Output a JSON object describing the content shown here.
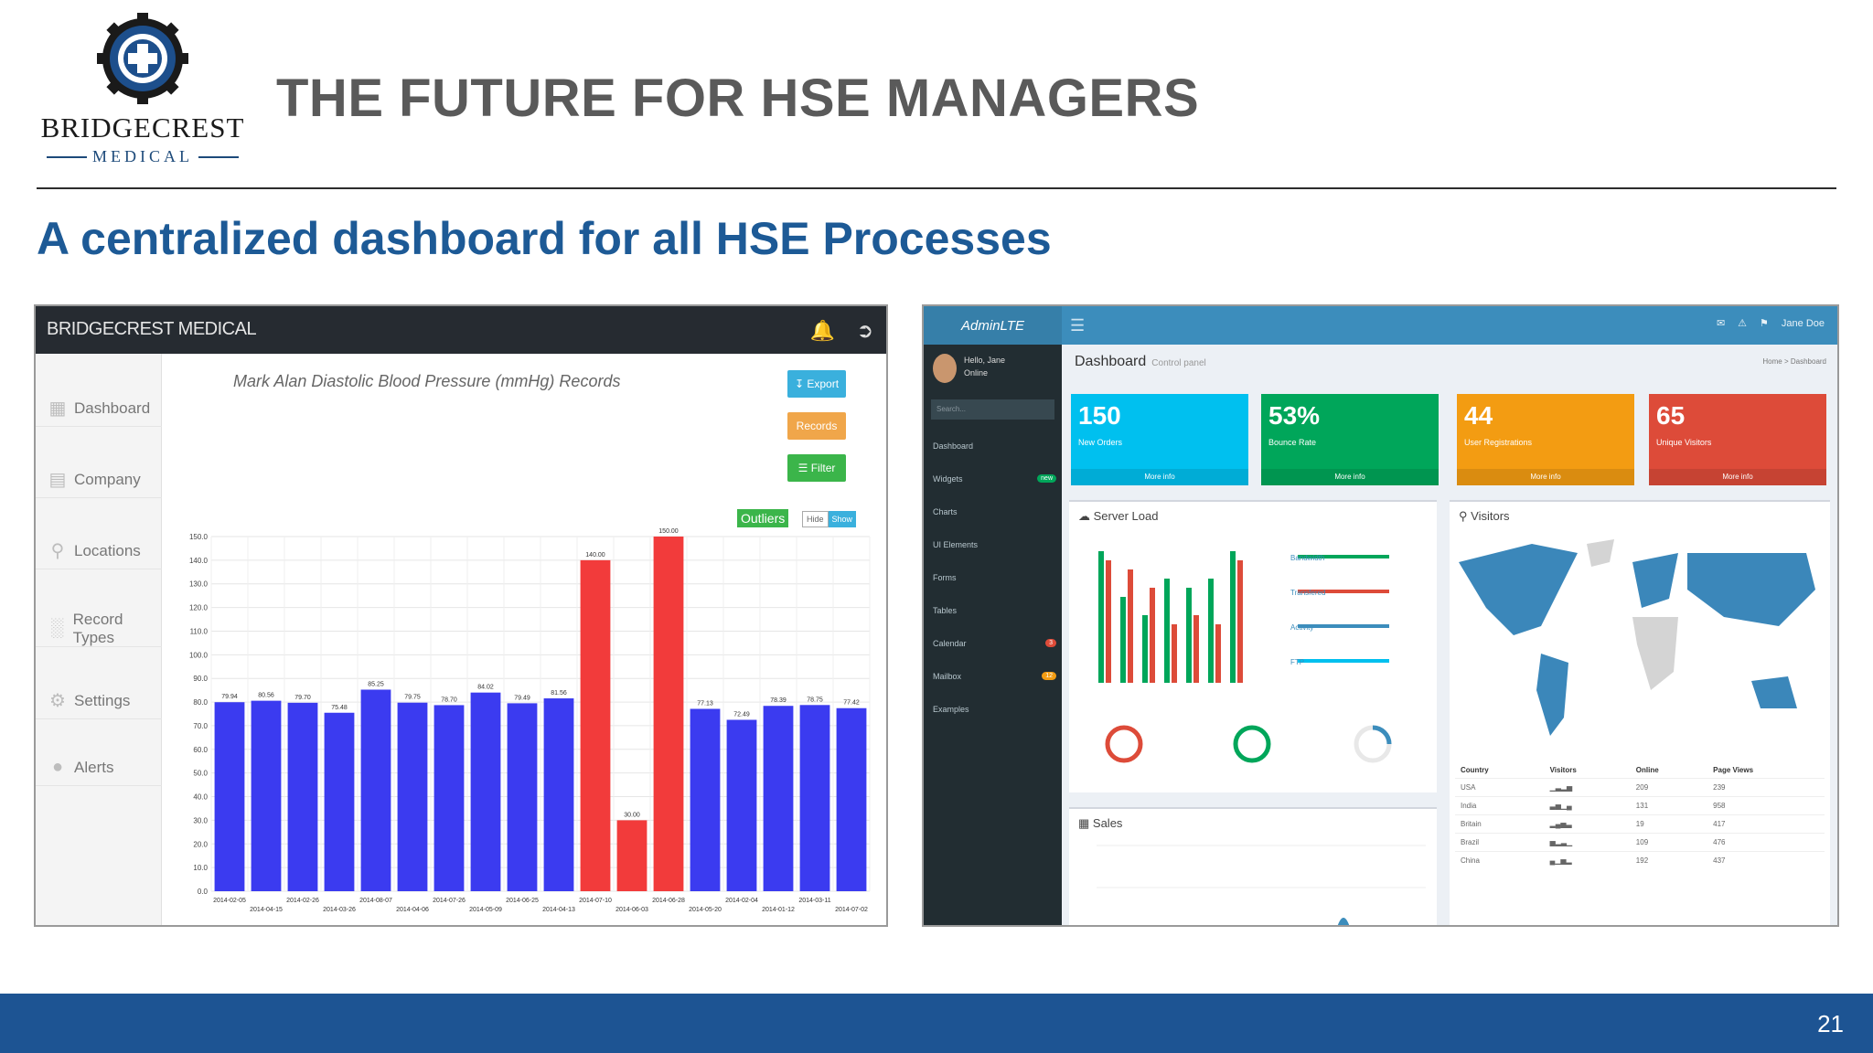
{
  "logo": {
    "name": "BRIDGECREST",
    "sub": "MEDICAL"
  },
  "slide": {
    "title": "THE FUTURE FOR HSE MANAGERS",
    "subtitle": "A centralized dashboard for all HSE Processes",
    "page_number": "21"
  },
  "left_app": {
    "brand": "BRIDGECREST MEDICAL",
    "sidebar": [
      "Dashboard",
      "Company",
      "Locations",
      "Record Types",
      "Settings",
      "Alerts"
    ],
    "buttons": {
      "export": "Export",
      "records": "Records",
      "filter": "Filter"
    },
    "outliers_label": "Outliers",
    "toggle": {
      "hide": "Hide",
      "show": "Show"
    }
  },
  "chart_data": {
    "type": "bar",
    "title": "Mark Alan Diastolic Blood Pressure (mmHg) Records",
    "categories": [
      "2014-02-05",
      "2014-04-15",
      "2014-02-26",
      "2014-03-26",
      "2014-08-07",
      "2014-04-06",
      "2014-07-26",
      "2014-05-09",
      "2014-06-25",
      "2014-04-13",
      "2014-07-10",
      "2014-06-03",
      "2014-06-28",
      "2014-05-20",
      "2014-02-04",
      "2014-01-12",
      "2014-03-11",
      "2014-07-02"
    ],
    "values": [
      79.94,
      80.56,
      79.7,
      75.48,
      85.25,
      79.75,
      78.7,
      84.02,
      79.49,
      81.56,
      140.0,
      30.0,
      150.0,
      77.13,
      72.49,
      78.39,
      78.75,
      77.42
    ],
    "value_labels": [
      "79.94",
      "80.56",
      "79.70",
      "75.48",
      "85.25",
      "79.75",
      "78.70",
      "84.02",
      "79.49",
      "81.56",
      "140.00",
      "30.00",
      "150.00",
      "77.13",
      "72.49",
      "78.39",
      "78.75",
      "77.42"
    ],
    "outliers": [
      false,
      false,
      false,
      false,
      false,
      false,
      false,
      false,
      false,
      false,
      true,
      true,
      true,
      false,
      false,
      false,
      false,
      false
    ],
    "ylim": [
      0,
      150
    ],
    "yticks": [
      "0.0",
      "10.0",
      "20.0",
      "30.0",
      "40.0",
      "50.0",
      "60.0",
      "70.0",
      "80.0",
      "90.0",
      "100.0",
      "110.0",
      "120.0",
      "130.0",
      "140.0",
      "150.0"
    ],
    "colors": {
      "normal": "#3b3bf0",
      "outlier": "#f23b3b"
    },
    "grid": true
  },
  "right_app": {
    "brand": "AdminLTE",
    "user": "Jane Doe",
    "hello": "Hello, Jane",
    "status": "Online",
    "search_placeholder": "Search...",
    "menu": [
      "Dashboard",
      "Widgets",
      "Charts",
      "UI Elements",
      "Forms",
      "Tables",
      "Calendar",
      "Mailbox",
      "Examples"
    ],
    "page_title": "Dashboard",
    "page_subtitle": "Control panel",
    "breadcrumb": "Home > Dashboard",
    "stat_boxes": [
      {
        "value": "150",
        "label": "New Orders",
        "more": "More info",
        "color": "#00c0ef"
      },
      {
        "value": "53%",
        "label": "Bounce Rate",
        "more": "More info",
        "color": "#00a65a"
      },
      {
        "value": "44",
        "label": "User Registrations",
        "more": "More info",
        "color": "#f39c12"
      },
      {
        "value": "65",
        "label": "Unique Visitors",
        "more": "More info",
        "color": "#dd4b39"
      }
    ],
    "server_load_title": "Server Load",
    "server_stats": [
      "Bandwidth",
      "Transfered",
      "Activity",
      "FTP"
    ],
    "visitors_title": "Visitors",
    "sales_title": "Sales",
    "visitors_table": {
      "headers": [
        "Country",
        "Visitors",
        "Online",
        "Page Views"
      ],
      "rows": [
        [
          "USA",
          "",
          "209",
          "239"
        ],
        [
          "India",
          "",
          "131",
          "958"
        ],
        [
          "Britain",
          "",
          "19",
          "417"
        ],
        [
          "Brazil",
          "",
          "109",
          "476"
        ],
        [
          "China",
          "",
          "192",
          "437"
        ]
      ]
    }
  }
}
